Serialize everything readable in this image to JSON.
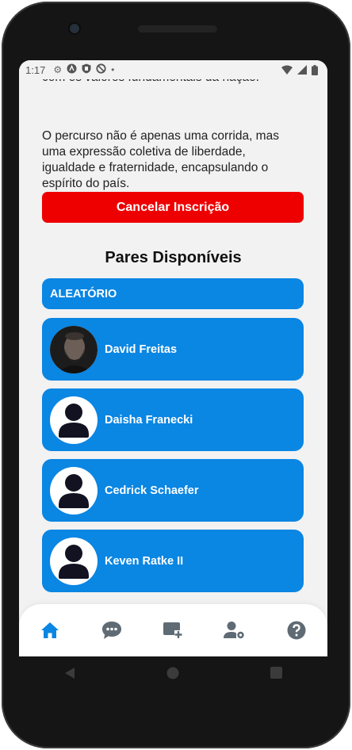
{
  "status_bar": {
    "time": "1:17"
  },
  "content": {
    "cut_text": "com os valores fundamentais da nação.",
    "paragraph": "O percurso não é apenas uma corrida, mas uma expressão coletiva de liberdade, igualdade e fraternidade, encapsulando o espírito do país.",
    "cancel_button": "Cancelar Inscrição",
    "section_title": "Pares Disponíveis",
    "random_button": "ALEATÓRIO",
    "pairs": [
      {
        "name": "David Freitas"
      },
      {
        "name": "Daisha Franecki"
      },
      {
        "name": "Cedrick Schaefer"
      },
      {
        "name": "Keven Ratke II"
      }
    ]
  },
  "bottom_nav": [
    "home-icon",
    "chat-icon",
    "add-card-icon",
    "user-settings-icon",
    "help-icon"
  ],
  "colors": {
    "accent": "#0a86e3",
    "danger": "#ee0000",
    "background": "#f2f2f2"
  }
}
